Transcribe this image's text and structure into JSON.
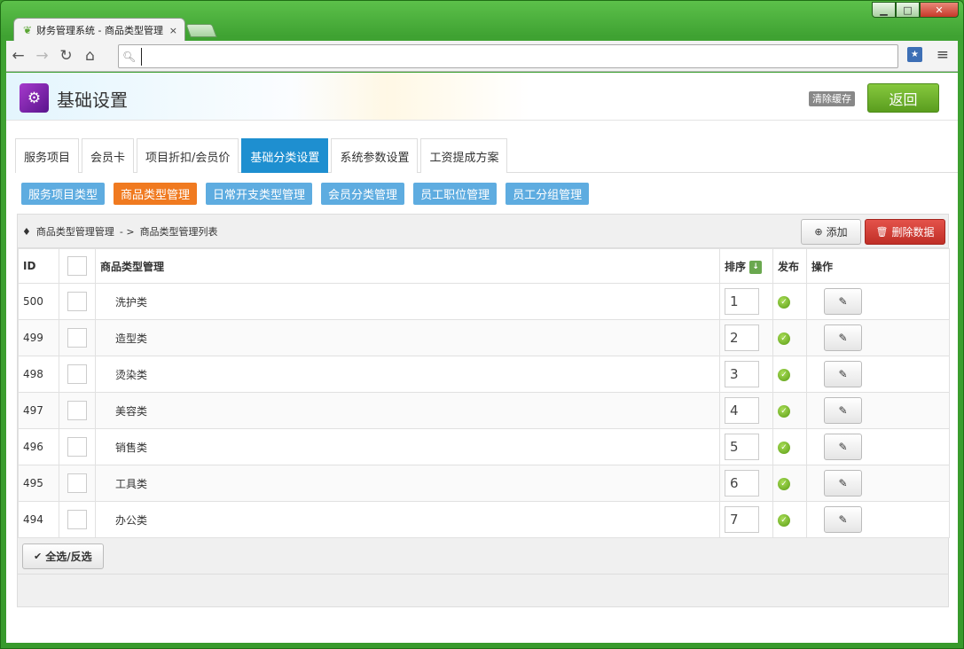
{
  "browser": {
    "tab_title": "财务管理系统 - 商品类型管理",
    "tab_close": "×",
    "address_value": ""
  },
  "header": {
    "title": "基础设置",
    "clear_cache": "清除缓存",
    "back": "返回"
  },
  "main_tabs": [
    "服务项目",
    "会员卡",
    "项目折扣/会员价",
    "基础分类设置",
    "系统参数设置",
    "工资提成方案"
  ],
  "sub_tabs": [
    "服务项目类型",
    "商品类型管理",
    "日常开支类型管理",
    "会员分类管理",
    "员工职位管理",
    "员工分组管理"
  ],
  "breadcrumb": {
    "first": "商品类型管理管理",
    "sep": "- >",
    "second": "商品类型管理列表"
  },
  "actions": {
    "add": "添加",
    "delete": "删除数据"
  },
  "table": {
    "headers": {
      "id": "ID",
      "name": "商品类型管理",
      "order": "排序",
      "publish": "发布",
      "ops": "操作"
    },
    "rows": [
      {
        "id": "500",
        "name": "洗护类",
        "order": "1"
      },
      {
        "id": "499",
        "name": "造型类",
        "order": "2"
      },
      {
        "id": "498",
        "name": "烫染类",
        "order": "3"
      },
      {
        "id": "497",
        "name": "美容类",
        "order": "4"
      },
      {
        "id": "496",
        "name": "销售类",
        "order": "5"
      },
      {
        "id": "495",
        "name": "工具类",
        "order": "6"
      },
      {
        "id": "494",
        "name": "办公类",
        "order": "7"
      }
    ]
  },
  "footer": {
    "select_all": "全选/反选"
  },
  "colors": {
    "active_main_tab": "#1e8fd0",
    "active_sub_tab": "#f07a20",
    "sub_tab": "#5eace0",
    "back_button": "#6aad28",
    "delete_button": "#d1403a"
  }
}
